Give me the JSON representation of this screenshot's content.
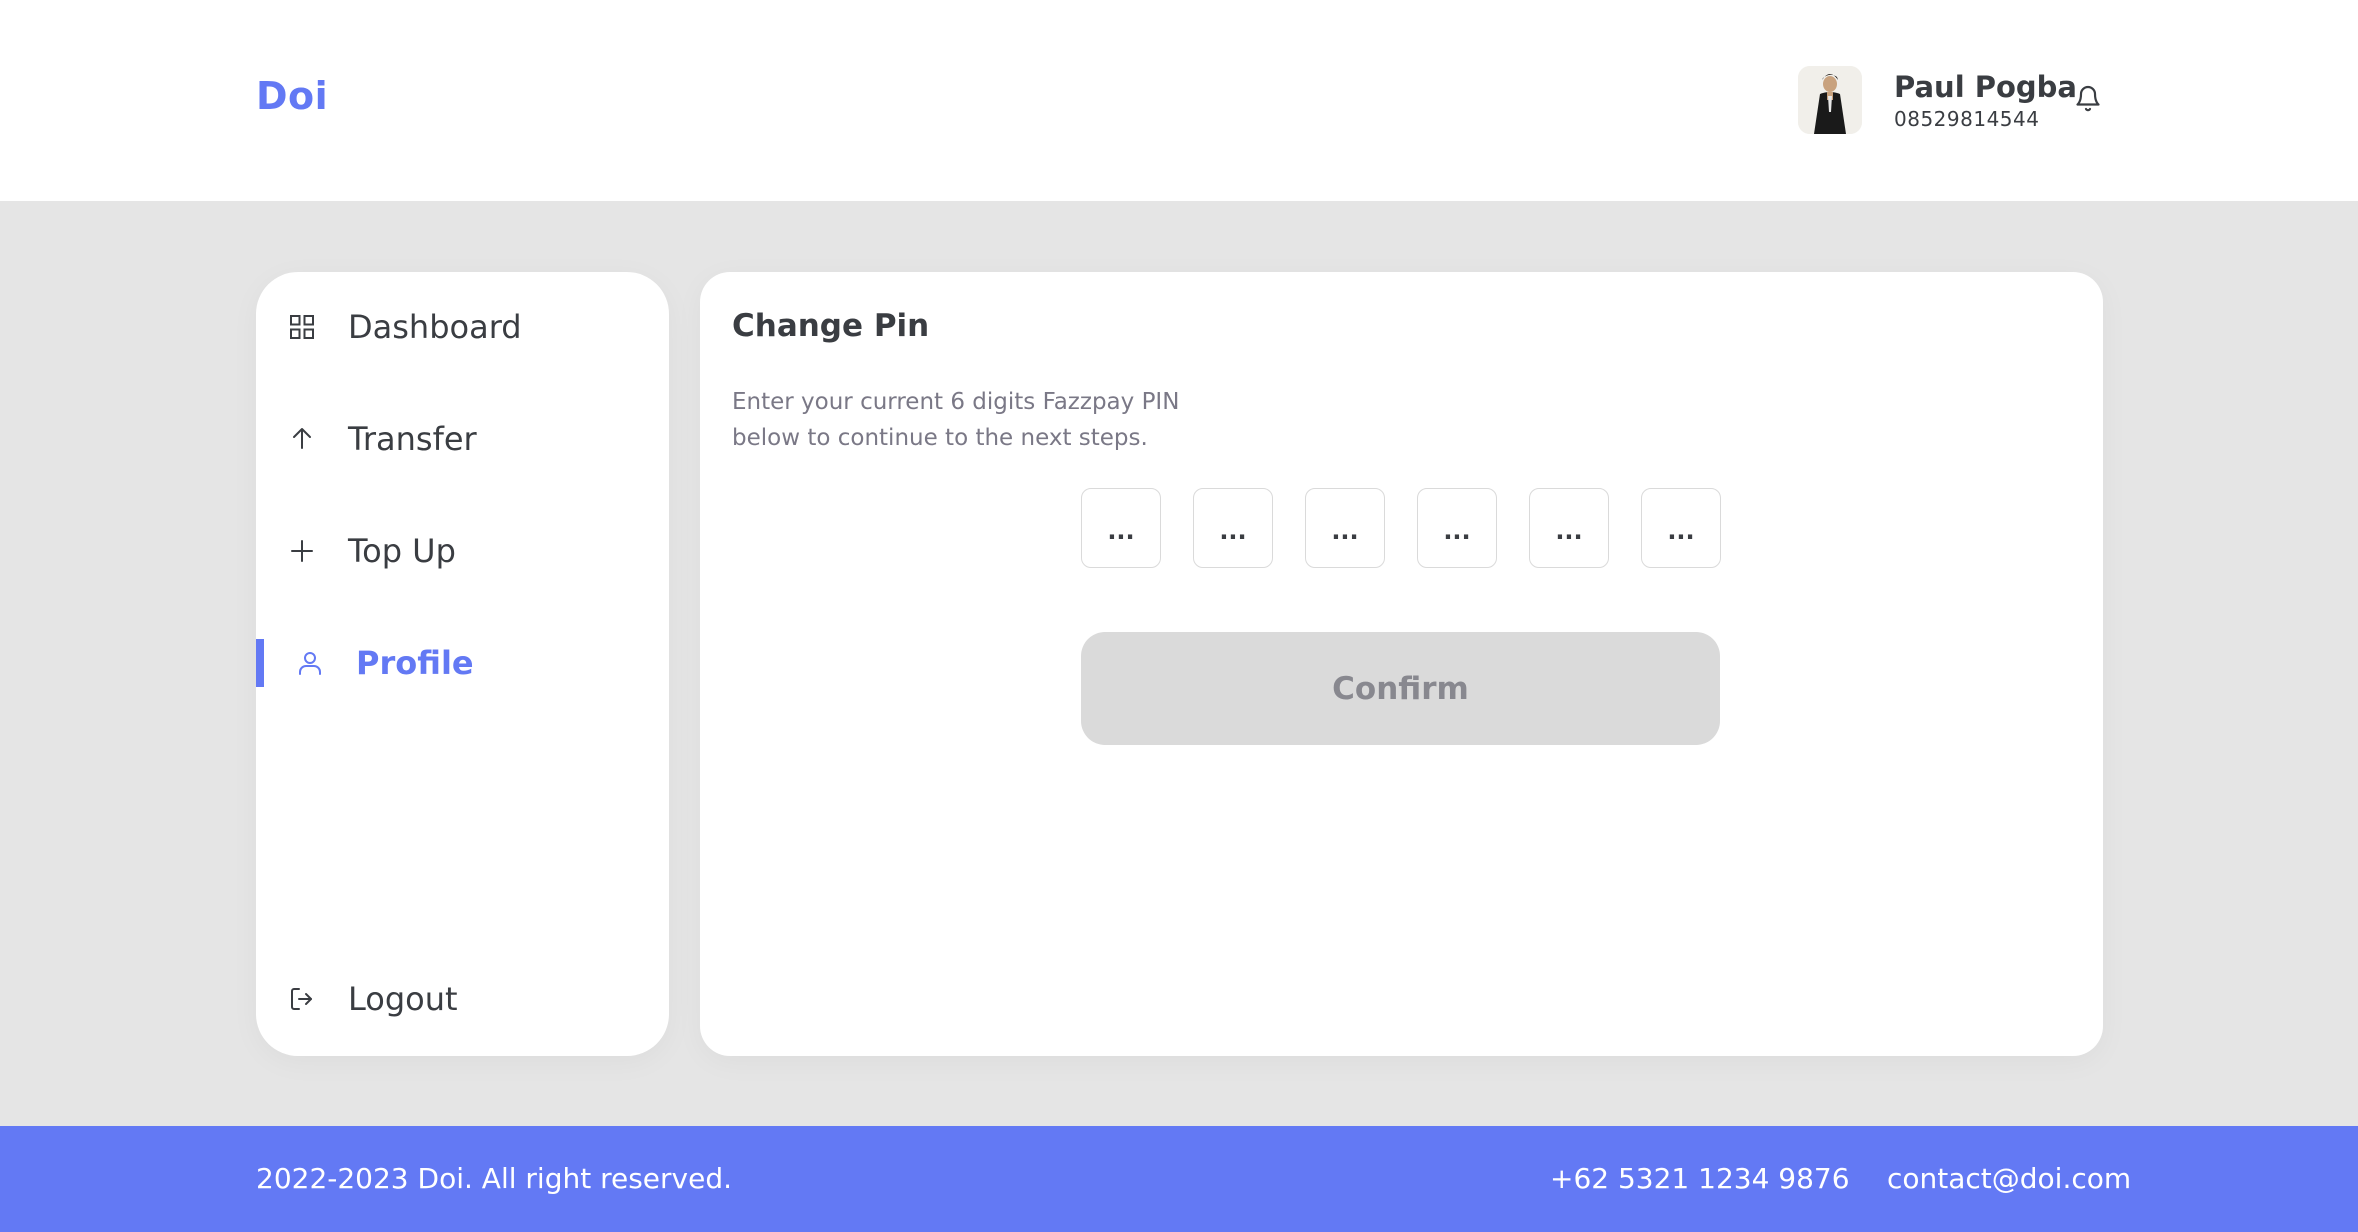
{
  "header": {
    "brand": "Doi",
    "user": {
      "name": "Paul Pogba",
      "phone": "08529814544"
    },
    "icons": {
      "bell": "bell-icon",
      "avatar": "user-avatar"
    }
  },
  "sidebar": {
    "items": [
      {
        "label": "Dashboard",
        "icon": "grid-icon",
        "active": false
      },
      {
        "label": "Transfer",
        "icon": "arrow-up-icon",
        "active": false
      },
      {
        "label": "Top Up",
        "icon": "plus-icon",
        "active": false
      },
      {
        "label": "Profile",
        "icon": "user-icon",
        "active": true
      }
    ],
    "logout": {
      "label": "Logout",
      "icon": "logout-icon"
    }
  },
  "main": {
    "title": "Change Pin",
    "description": "Enter your current 6 digits Fazzpay PIN below to continue to the next steps.",
    "pin_placeholders": [
      "...",
      "...",
      "...",
      "...",
      "...",
      "..."
    ],
    "confirm_label": "Confirm"
  },
  "footer": {
    "copyright": "2022-2023 Doi. All right reserved.",
    "phone": "+62 5321 1234 9876",
    "email": "contact@doi.com"
  },
  "colors": {
    "accent": "#6379f4",
    "background": "#e5e5e5",
    "text": "#3a3d42",
    "muted": "#7a7886",
    "disabled_button": "#dadada"
  }
}
